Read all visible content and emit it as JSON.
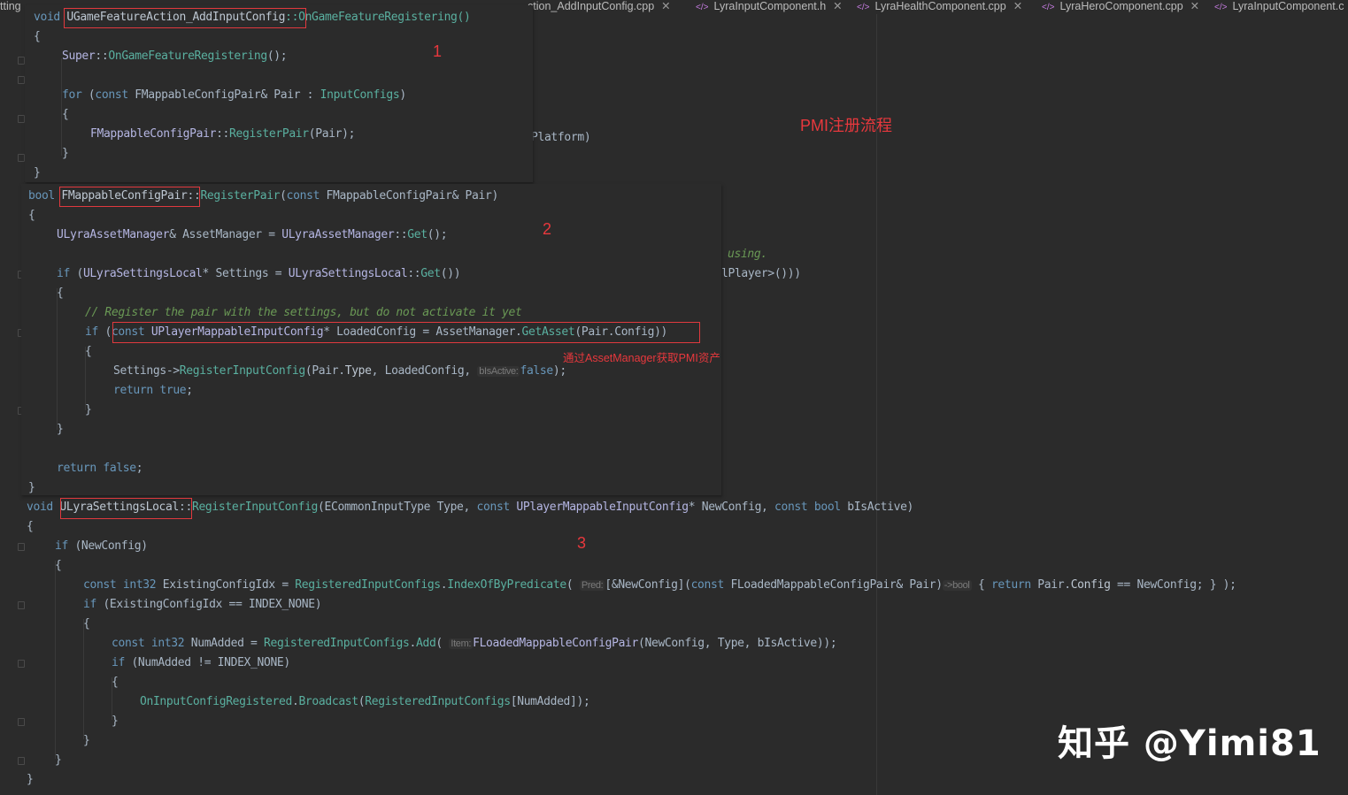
{
  "tabs": [
    {
      "label": "tting"
    },
    {
      "label": ""
    },
    {
      "label": "ction_AddInputConfig.cpp"
    },
    {
      "label": "LyraInputComponent.h"
    },
    {
      "label": "LyraHealthComponent.cpp"
    },
    {
      "label": "LyraHeroComponent.cpp"
    },
    {
      "label": "LyraInputComponent.c"
    }
  ],
  "annotations": {
    "title": "PMI注册流程",
    "note": "通过AssetManager获取PMI资产",
    "step1": "1",
    "step2": "2",
    "step3": "3"
  },
  "background_fragments": {
    "f1": "Platform)",
    "f2": "using.",
    "f3": "lPlayer>()))"
  },
  "code1": {
    "l1_kw": "void",
    "l1_cls": "UGameFeatureAction_AddInputConfig",
    "l1_rest": "::OnGameFeatureRegistering()",
    "l2": "{",
    "l3_a": "Super",
    "l3_b": "::",
    "l3_c": "OnGameFeatureRegistering",
    "l3_d": "();",
    "l4_for": "for",
    "l4_a": " (",
    "l4_const": "const",
    "l4_b": " FMappableConfigPair& Pair : ",
    "l4_c": "InputConfigs",
    "l4_d": ")",
    "l5": "{",
    "l6_a": "FMappableConfigPair",
    "l6_b": "::",
    "l6_c": "RegisterPair",
    "l6_d": "(Pair);",
    "l7": "}",
    "l8": "}"
  },
  "code2": {
    "l1_kw": "bool",
    "l1_cls": "FMappableConfigPair",
    "l1_b": "::",
    "l1_fn": "RegisterPair",
    "l1_c": "(",
    "l1_const": "const",
    "l1_d": " FMappableConfigPair& Pair)",
    "l2": "{",
    "l3_a": "ULyraAssetManager",
    "l3_b": "& AssetManager = ",
    "l3_c": "ULyraAssetManager",
    "l3_d": "::",
    "l3_e": "Get",
    "l3_f": "();",
    "l4_if": "if",
    "l4_a": " (",
    "l4_b": "ULyraSettingsLocal",
    "l4_c": "* Settings = ",
    "l4_d": "ULyraSettingsLocal",
    "l4_e": "::",
    "l4_f": "Get",
    "l4_g": "())",
    "l5": "{",
    "l6": "// Register the pair with the settings, but do not activate it yet",
    "l7_if": "if",
    "l7_a": " (",
    "l7_const": "const",
    "l7_b": " ",
    "l7_c": "UPlayerMappableInputConfig",
    "l7_d": "* LoadedConfig = AssetManager.",
    "l7_e": "GetAsset",
    "l7_f": "(Pair.Config))",
    "l8": "{",
    "l9_a": "Settings->",
    "l9_b": "RegisterInputConfig",
    "l9_c": "(Pair.",
    "l9_d": "Type",
    "l9_e": ", LoadedConfig, ",
    "l9_hint": "bIsActive:",
    "l9_f": "false",
    "l9_g": ");",
    "l10_ret": "return",
    "l10_true": "true",
    "l10_semi": ";",
    "l11": "}",
    "l12": "}",
    "l13_ret": "return",
    "l13_false": "false",
    "l13_semi": ";",
    "l14": "}"
  },
  "code3": {
    "l1_kw": "void",
    "l1_cls": "ULyraSettingsLocal",
    "l1_b": "::",
    "l1_fn": "RegisterInputConfig",
    "l1_c": "(ECommonInputType ",
    "l1_d": "Type",
    "l1_e": ", ",
    "l1_const": "const",
    "l1_f": " ",
    "l1_g": "UPlayerMappableInputConfig",
    "l1_h": "* NewConfig, ",
    "l1_const2": "const",
    "l1_bool": " bool",
    "l1_i": " bIsActive)",
    "l2": "{",
    "l3_if": "if",
    "l3_a": " (NewConfig)",
    "l4": "{",
    "l5_const": "const",
    "l5_int": " int32",
    "l5_a": " ExistingConfigIdx = ",
    "l5_b": "RegisteredInputConfigs",
    "l5_c": ".",
    "l5_d": "IndexOfByPredicate",
    "l5_e": "( ",
    "l5_hint": "Pred:",
    "l5_f": "[&NewConfig](",
    "l5_g": " FLoadedMappableConfigPair& Pair)",
    "l5_hint2": "->bool",
    "l5_h": " { ",
    "l5_ret": "return",
    "l5_i": " Pair.",
    "l5_j": "Config",
    "l5_k": " == NewConfig; } );",
    "l6_if": "if",
    "l6_a": " (ExistingConfigIdx == INDEX_NONE)",
    "l7": "{",
    "l8_const": "const",
    "l8_int": " int32",
    "l8_a": " NumAdded = ",
    "l8_b": "RegisteredInputConfigs",
    "l8_c": ".",
    "l8_d": "Add",
    "l8_e": "( ",
    "l8_hint": "Item:",
    "l8_f": "FLoadedMappableConfigPair",
    "l8_g": "(NewConfig, Type, bIsActive));",
    "l9_if": "if",
    "l9_a": " (NumAdded != INDEX_NONE)",
    "l10": "{",
    "l11_a": "OnInputConfigRegistered",
    "l11_b": ".",
    "l11_c": "Broadcast",
    "l11_d": "(",
    "l11_e": "RegisteredInputConfigs",
    "l11_f": "[NumAdded]);",
    "l12": "}",
    "l13": "}",
    "l14": "}",
    "l15": "}"
  },
  "watermark": "知乎 @Yimi81"
}
